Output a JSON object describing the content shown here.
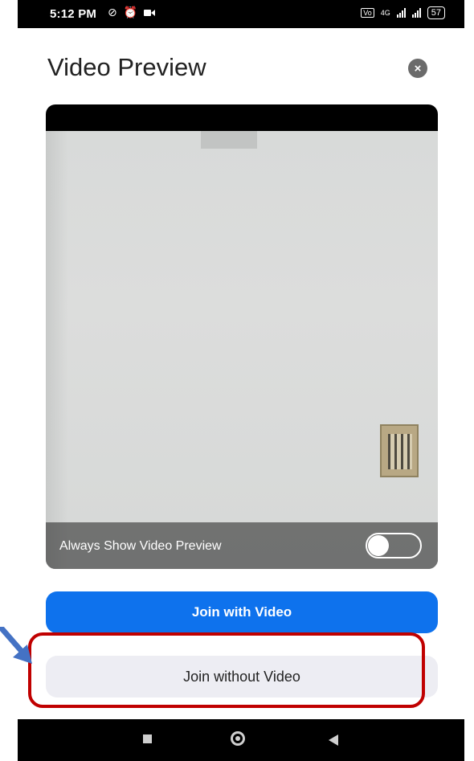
{
  "status_bar": {
    "time": "5:12 PM",
    "battery": "57",
    "network": "4G"
  },
  "header": {
    "title": "Video Preview",
    "close_icon": "close-icon"
  },
  "preview": {
    "label": "Always Show Video Preview",
    "toggle_on": false
  },
  "buttons": {
    "join_with_video": "Join with Video",
    "join_without_video": "Join without Video"
  },
  "colors": {
    "primary_blue": "#0e72ed",
    "secondary_gray": "#ededf3",
    "highlight_red": "#c00000",
    "arrow_blue": "#4472c4"
  },
  "nav_icons": [
    "recents-icon",
    "home-icon",
    "back-icon"
  ]
}
